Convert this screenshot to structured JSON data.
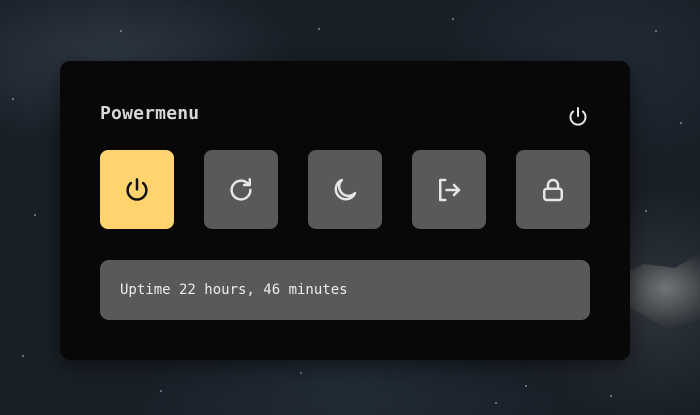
{
  "powermenu": {
    "title": "Powermenu",
    "header_icon": "power-icon",
    "actions": [
      {
        "id": "shutdown",
        "icon": "power-icon",
        "active": true
      },
      {
        "id": "reboot",
        "icon": "reboot-icon",
        "active": false
      },
      {
        "id": "suspend",
        "icon": "moon-icon",
        "active": false
      },
      {
        "id": "logout",
        "icon": "logout-icon",
        "active": false
      },
      {
        "id": "lock",
        "icon": "lock-icon",
        "active": false
      }
    ],
    "uptime": "Uptime 22 hours, 46 minutes"
  },
  "colors": {
    "panel_bg": "#080808",
    "button_bg": "#595959",
    "active_bg": "#ffd36e",
    "icon_light": "#e6e6e6",
    "icon_dark": "#111111",
    "text": "#d7d7d7"
  }
}
